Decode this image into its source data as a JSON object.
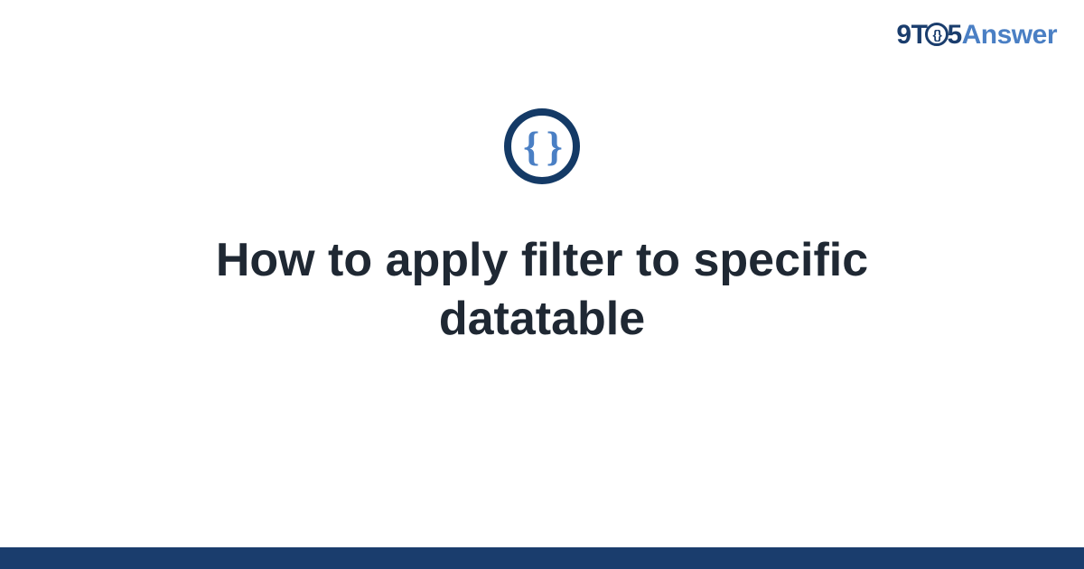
{
  "brand": {
    "part1": "9T",
    "dot_inner": "{}",
    "part2": "5",
    "part3": "Answer"
  },
  "icon": {
    "glyph": "{ }"
  },
  "title": "How to apply filter to specific datatable",
  "colors": {
    "dark_blue": "#1a3d6d",
    "light_blue": "#4a7fc4",
    "text": "#1f2833"
  }
}
